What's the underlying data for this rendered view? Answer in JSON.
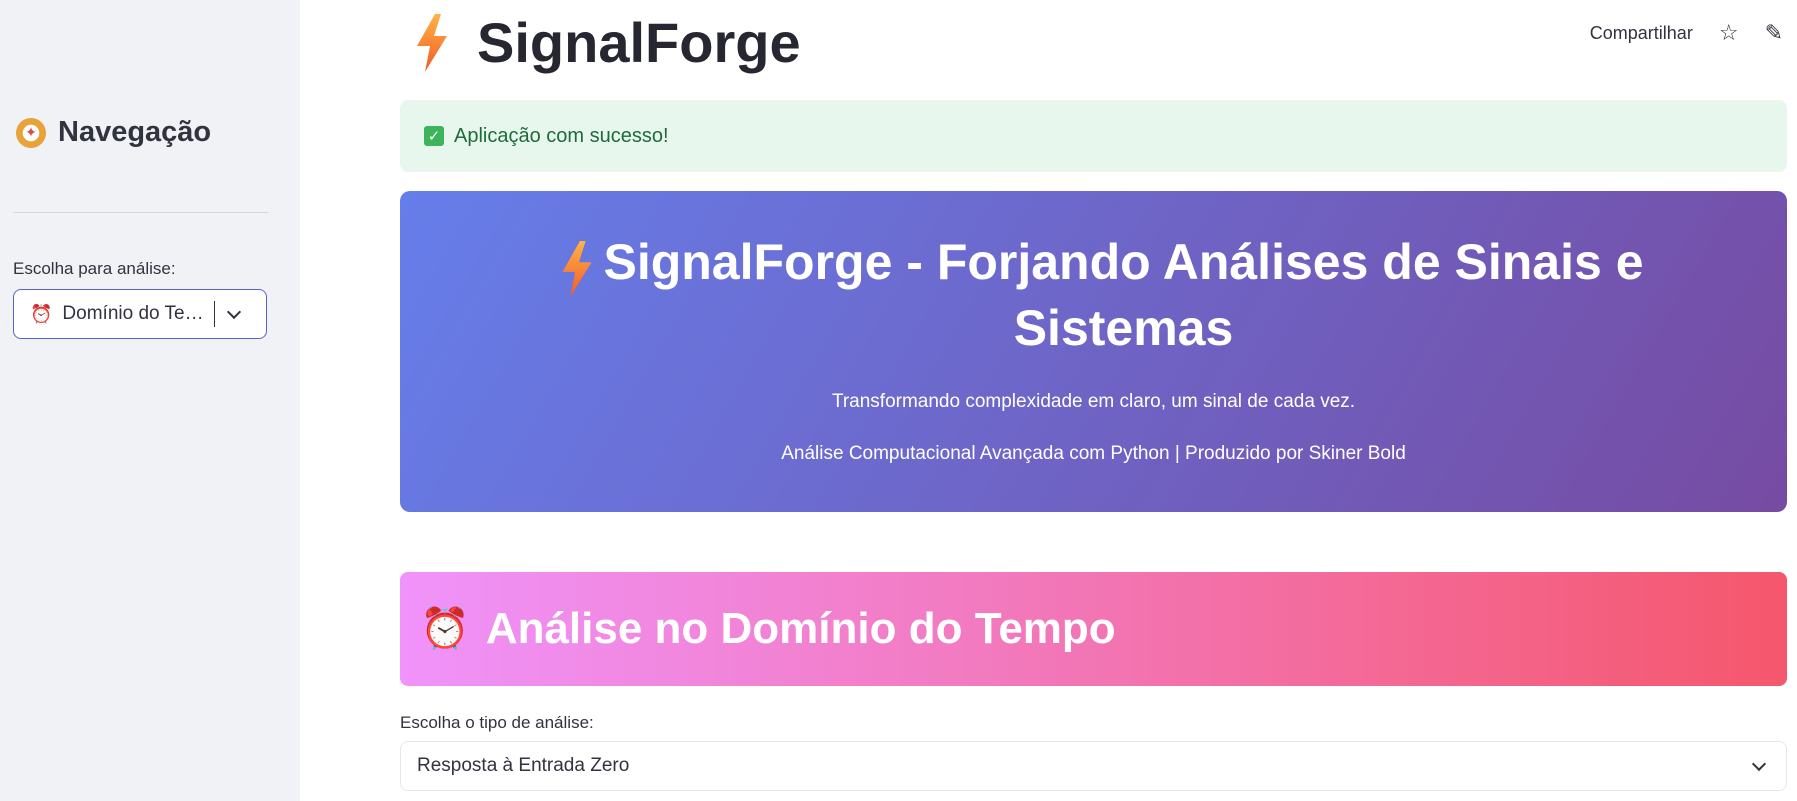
{
  "header": {
    "app_title": "SignalForge",
    "share_label": "Compartilhar",
    "star_glyph": "☆",
    "edit_glyph": "✎"
  },
  "sidebar": {
    "title": "Navegação",
    "select_label": "Escolha para análise:",
    "select_value": "Domínio do Tempo"
  },
  "alert": {
    "message": "Aplicação com sucesso!",
    "check_glyph": "✓"
  },
  "hero": {
    "title": "SignalForge - Forjando Análises de Sinais e Sistemas",
    "subtitle": "Transformando complexidade em claro, um sinal de cada vez.",
    "credits": "Análise Computacional Avançada com Python | Produzido por Skiner Bold"
  },
  "section": {
    "title": "Análise no Domínio do Tempo",
    "alarm_glyph": "⏰"
  },
  "analysis": {
    "label": "Escolha o tipo de análise:",
    "value": "Resposta à Entrada Zero"
  },
  "colors": {
    "hero_gradient_start": "#667eea",
    "hero_gradient_end": "#764ba2",
    "section_gradient_start": "#f093fb",
    "section_gradient_end": "#f5576c",
    "success_bg": "#e8f7ee",
    "success_text": "#1e6b3a"
  }
}
